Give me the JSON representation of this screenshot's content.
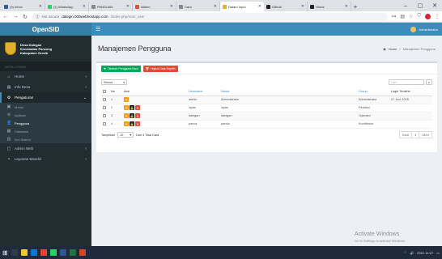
{
  "browser": {
    "tabs": [
      {
        "title": "(9) Inbox",
        "color": "#3b5998"
      },
      {
        "title": "(1) WhatsApp",
        "color": "#25d366"
      },
      {
        "title": "PANDUAN",
        "color": "#888888"
      },
      {
        "title": "sistem",
        "color": "#e74c3c"
      },
      {
        "title": "Cara",
        "color": "#888888"
      },
      {
        "title": "Dalam Input",
        "color": "#e1b12c",
        "active": true
      },
      {
        "title": "Github",
        "color": "#222222"
      },
      {
        "title": "Home",
        "color": "#222222"
      }
    ],
    "new_tab": "+",
    "url_secure": "Not secure",
    "url_host": "dalegin.000webhostapp.com",
    "url_path": "/index.php/man_user"
  },
  "app": {
    "logo": "OpenSID",
    "user_label": "Administrator"
  },
  "sidebar": {
    "village_line1": "Desa Dalegan",
    "village_line2": "Kecamatan Panceng",
    "village_line3": "Kabupaten Gresik",
    "menu_header": "MENU UTAMA",
    "items": [
      {
        "label": "Home",
        "icon": "home-icon",
        "glyph": "⌂"
      },
      {
        "label": "Info Desa",
        "icon": "info-icon",
        "glyph": "▤"
      },
      {
        "label": "Pengaturan",
        "icon": "gear-icon",
        "glyph": "⚙",
        "active": true
      }
    ],
    "subitems": [
      {
        "label": "Modul",
        "glyph": "▣"
      },
      {
        "label": "Aplikasi",
        "glyph": "⚙"
      },
      {
        "label": "Pengguna",
        "glyph": "👤",
        "active": true
      },
      {
        "label": "Database",
        "glyph": "▦"
      },
      {
        "label": "Info Sistem",
        "glyph": "▥"
      }
    ],
    "bottom_items": [
      {
        "label": "Admin Web",
        "glyph": "▢"
      },
      {
        "label": "Layanan Mandiri",
        "glyph": "◓"
      }
    ]
  },
  "content": {
    "title": "Manajemen Pengguna",
    "breadcrumb_home": "Home",
    "breadcrumb_current": "Manajemen Pengguna",
    "btn_add": "Tambah Pengguna Baru",
    "btn_delete": "Hapus Data Terpilih",
    "filter_select": "Semua",
    "search_placeholder": "Cari...",
    "columns": [
      "No",
      "Aksi",
      "Username",
      "Nama",
      "Group",
      "Login Terakhir"
    ],
    "rows": [
      {
        "no": "1",
        "username": "admin",
        "nama": "Administrator",
        "group": "Administrator",
        "login": "07 Juni 2018",
        "lock": false
      },
      {
        "no": "2",
        "username": "layan",
        "nama": "layan",
        "group": "Redaksi",
        "login": "",
        "lock": true
      },
      {
        "no": "3",
        "username": "dalegan",
        "nama": "dalegan",
        "group": "Operator",
        "login": "",
        "lock": true
      },
      {
        "no": "4",
        "username": "panca",
        "nama": "panda",
        "group": "Kontributor",
        "login": "",
        "lock": true
      }
    ],
    "tampilkan_label": "Tampilkan",
    "tampilkan_value": "10",
    "total_text": "Dari 4 Total Data",
    "pagination": [
      "Awal",
      "1",
      "Akhir"
    ]
  },
  "watermark": {
    "line1": "Activate Windows",
    "line2": "Go to Settings to activate Windows."
  },
  "taskbar": {
    "clock": "ENG  14:27"
  }
}
